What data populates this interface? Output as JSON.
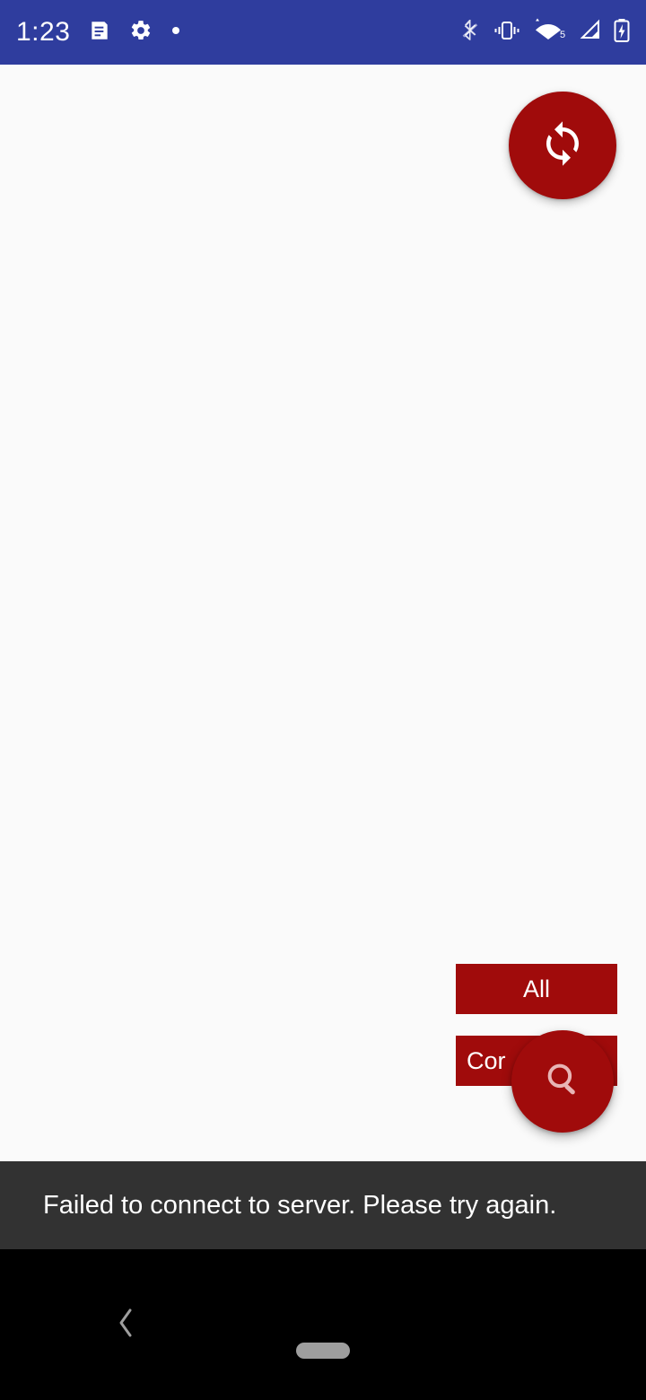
{
  "status_bar": {
    "background_color": "#2F3D9E",
    "clock": "1:23",
    "left_icons": [
      {
        "name": "notes-notification-icon",
        "glyph": "notes"
      },
      {
        "name": "settings-gear-icon",
        "glyph": "gear"
      },
      {
        "name": "dot-notification-icon",
        "glyph": "dot"
      }
    ],
    "right_icons": [
      {
        "name": "bluetooth-disabled-icon",
        "glyph": "bluetooth-slash"
      },
      {
        "name": "vibrate-mode-icon",
        "glyph": "vibrate"
      },
      {
        "name": "wifi-icon",
        "glyph": "wifi",
        "badge": "5"
      },
      {
        "name": "cellular-signal-icon",
        "glyph": "signal"
      },
      {
        "name": "battery-charging-icon",
        "glyph": "battery-charging"
      }
    ]
  },
  "content": {
    "background_color": "#FAFAFA",
    "accent_color": "#A00B0B",
    "sync_fab": {
      "label": "",
      "icon": "sync-icon"
    },
    "search_fab": {
      "label": "",
      "icon": "search-icon"
    },
    "filter_buttons": [
      {
        "label": "All"
      },
      {
        "label": "Cor"
      }
    ]
  },
  "snackbar": {
    "message": "Failed to connect to server. Please try again.",
    "background_color": "#323232",
    "text_color": "#FFFFFF"
  },
  "nav_bar": {
    "background_color": "#000000",
    "back_label": "",
    "home_label": ""
  }
}
